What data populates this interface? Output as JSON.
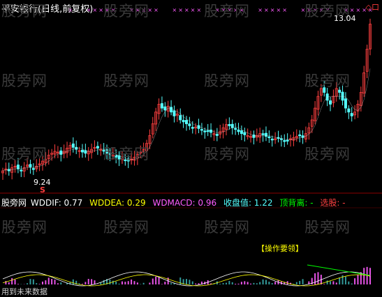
{
  "title": "平安银行(日线,前复权)",
  "watermark": "股旁网",
  "price_labels": {
    "high": "13.04",
    "low": "9.24",
    "signal_mark": "S"
  },
  "right_icons": "◇口",
  "indicator_bar": {
    "prefix": "股旁网",
    "wddif": "WDDIF: 0.77",
    "wddea": "WDDEA: 0.29",
    "wdmacd": "WDMACD: 0.96",
    "close": "收盘值: 1.22",
    "divergence": "顶背离: -",
    "pick": "选股: -"
  },
  "ops_title": "【操作要领】",
  "footer": "用到未来数据",
  "colors": {
    "up": "#ff4040",
    "down": "#54ffff",
    "pink": "#ff5cff",
    "yellow": "#ffff00",
    "white": "#ffffff",
    "green": "#00ff00",
    "grid": "#8b0000"
  },
  "chart_data": {
    "type": "candlestick",
    "price": {
      "title": "平安银行(日线,前复权)",
      "high_label": 13.04,
      "low_label": 9.24,
      "close": [
        9.3,
        9.35,
        9.3,
        9.38,
        9.42,
        9.35,
        9.32,
        9.38,
        9.45,
        9.4,
        9.36,
        9.42,
        9.48,
        9.55,
        9.6,
        9.7,
        9.75,
        9.8,
        9.78,
        9.72,
        9.8,
        9.88,
        9.95,
        9.9,
        9.85,
        9.82,
        9.78,
        9.75,
        9.8,
        9.85,
        9.9,
        9.88,
        9.85,
        9.8,
        9.75,
        9.72,
        9.7,
        9.65,
        9.6,
        9.62,
        9.58,
        9.55,
        9.6,
        9.65,
        9.72,
        9.78,
        9.85,
        10.0,
        10.2,
        10.5,
        10.8,
        11.0,
        10.9,
        10.85,
        10.95,
        10.8,
        10.7,
        10.75,
        10.6,
        10.55,
        10.5,
        10.45,
        10.4,
        10.42,
        10.38,
        10.35,
        10.3,
        10.32,
        10.28,
        10.25,
        10.2,
        10.3,
        10.4,
        10.48,
        10.45,
        10.4,
        10.38,
        10.3,
        10.25,
        10.22,
        10.2,
        10.18,
        10.15,
        10.2,
        10.25,
        10.22,
        10.18,
        10.15,
        10.1,
        10.12,
        10.15,
        10.1,
        10.05,
        10.08,
        10.12,
        10.15,
        10.18,
        10.2,
        10.15,
        10.25,
        10.4,
        10.6,
        10.9,
        11.2,
        11.4,
        11.3,
        11.1,
        11.0,
        11.2,
        11.4,
        11.3,
        11.1,
        10.9,
        10.8,
        10.7,
        10.8,
        11.0,
        11.3,
        11.8,
        12.4,
        13.04
      ],
      "ma_white": true
    },
    "indicator": {
      "WDDIF": 0.77,
      "WDDEA": 0.29,
      "WDMACD": 0.96,
      "收盘值": 1.22
    }
  }
}
